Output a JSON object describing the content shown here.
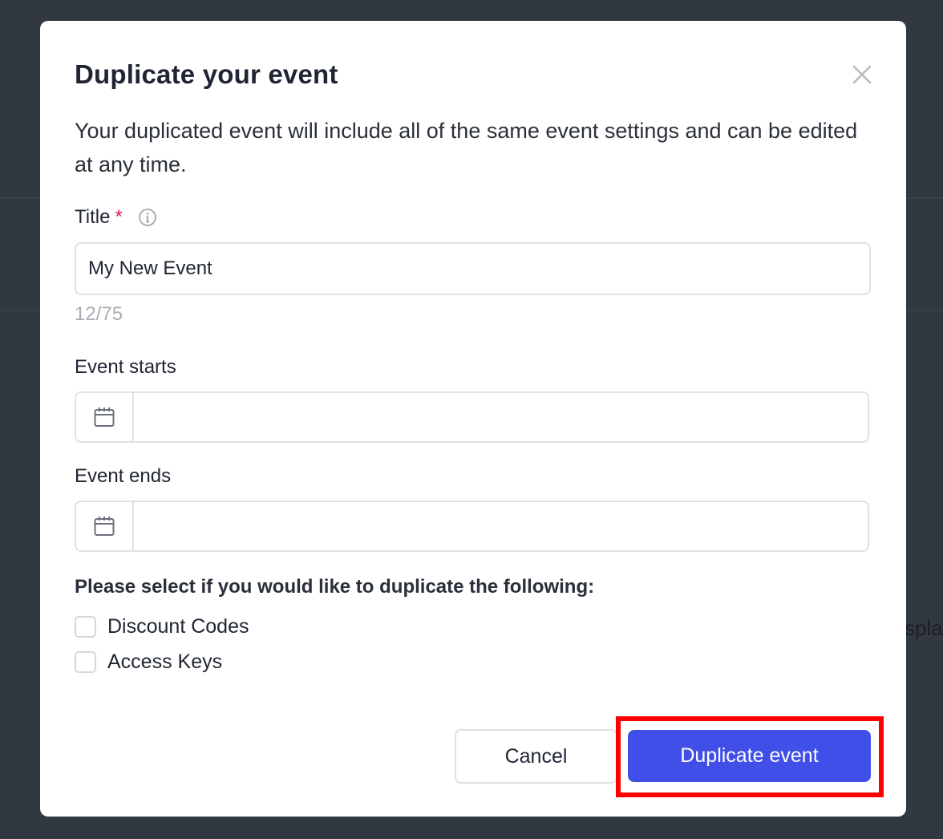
{
  "modal": {
    "title": "Duplicate your event",
    "description": "Your duplicated event will include all of the same event settings and can be edited at any time."
  },
  "form": {
    "title_label": "Title",
    "required_mark": "*",
    "title_value": "My New Event",
    "char_count": "12/75",
    "start_label": "Event starts",
    "start_value": "",
    "end_label": "Event ends",
    "end_value": "",
    "duplicate_heading": "Please select if you would like to duplicate the following:",
    "options": [
      {
        "label": "Discount Codes",
        "checked": false
      },
      {
        "label": "Access Keys",
        "checked": false
      }
    ]
  },
  "actions": {
    "cancel_label": "Cancel",
    "primary_label": "Duplicate event"
  },
  "background": {
    "partial_text": "spla"
  },
  "colors": {
    "primary": "#3f4fe8",
    "required": "#e5195a",
    "highlight": "#ff0000",
    "overlay": "#323840"
  },
  "icons": [
    "close-icon",
    "info-icon",
    "calendar-icon"
  ]
}
